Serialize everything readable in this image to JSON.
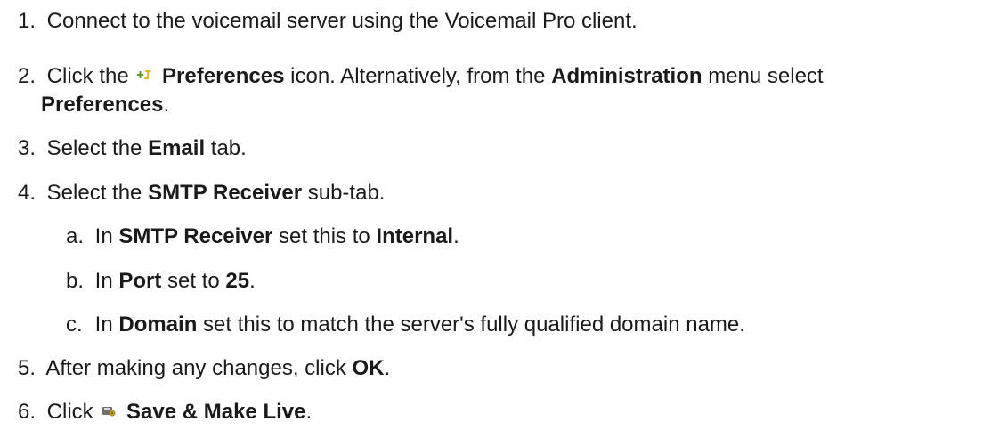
{
  "steps": [
    {
      "num": "1.",
      "text": "Connect to the voicemail server using the Voicemail Pro client."
    },
    {
      "num": "2.",
      "t1": "Click the",
      "b1": "Preferences",
      "t2": "icon. Alternatively, from the",
      "b2": "Administration",
      "t3": "menu select",
      "b3": "Preferences",
      "t4": ".",
      "icon": "preferences-icon"
    },
    {
      "num": "3.",
      "t1": "Select the",
      "b1": "Email",
      "t2": "tab."
    },
    {
      "num": "4.",
      "t1": "Select the",
      "b1": "SMTP Receiver",
      "t2": "sub-tab.",
      "substeps": [
        {
          "letter": "a.",
          "t1": "In",
          "b1": "SMTP Receiver",
          "t2": "set this to",
          "b2": "Internal",
          "t3": "."
        },
        {
          "letter": "b.",
          "t1": "In",
          "b1": "Port",
          "t2": "set to",
          "b2": "25",
          "t3": "."
        },
        {
          "letter": "c.",
          "t1": "In",
          "b1": "Domain",
          "t2": "set this to match the server's fully qualified domain name."
        }
      ]
    },
    {
      "num": "5.",
      "t1": "After making any changes, click",
      "b1": "OK",
      "t2": "."
    },
    {
      "num": "6.",
      "t1": "Click",
      "b1": "Save & Make Live",
      "t2": ".",
      "icon": "save-make-live-icon"
    }
  ],
  "colors": {
    "text": "#1a1a1a",
    "icon_green": "#5a9e2f",
    "icon_yellow": "#e5b72a"
  }
}
